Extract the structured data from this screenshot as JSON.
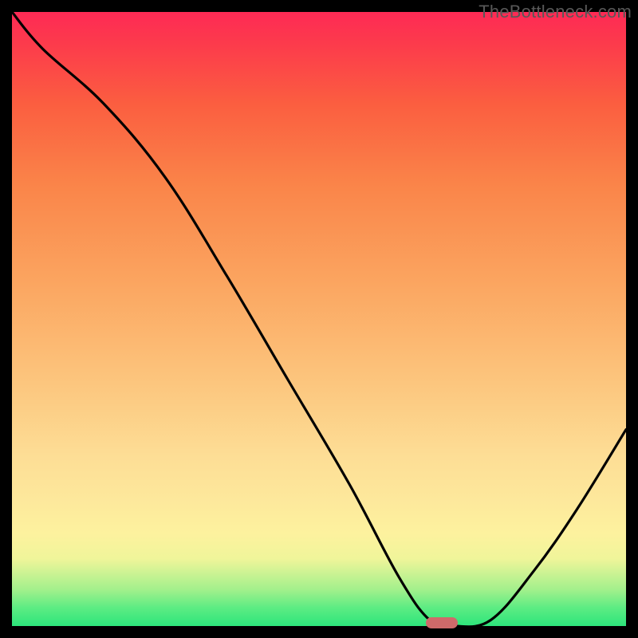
{
  "watermark": "TheBottleneck.com",
  "chart_data": {
    "type": "line",
    "title": "",
    "xlabel": "",
    "ylabel": "",
    "xlim": [
      0,
      100
    ],
    "ylim": [
      0,
      100
    ],
    "series": [
      {
        "name": "bottleneck-curve",
        "x": [
          0,
          5,
          15,
          25,
          35,
          45,
          55,
          63,
          68,
          72,
          78,
          85,
          92,
          100
        ],
        "y": [
          100,
          94,
          85,
          73,
          57,
          40,
          23,
          8,
          1,
          0,
          1,
          9,
          19,
          32
        ]
      }
    ],
    "marker": {
      "x": 70,
      "y": 0.5
    },
    "gradient_stops": [
      {
        "pos": 0,
        "color": "#2de57b"
      },
      {
        "pos": 11,
        "color": "#f0f59a"
      },
      {
        "pos": 40,
        "color": "#fcc57d"
      },
      {
        "pos": 72,
        "color": "#fa8449"
      },
      {
        "pos": 100,
        "color": "#fe2a55"
      }
    ]
  }
}
